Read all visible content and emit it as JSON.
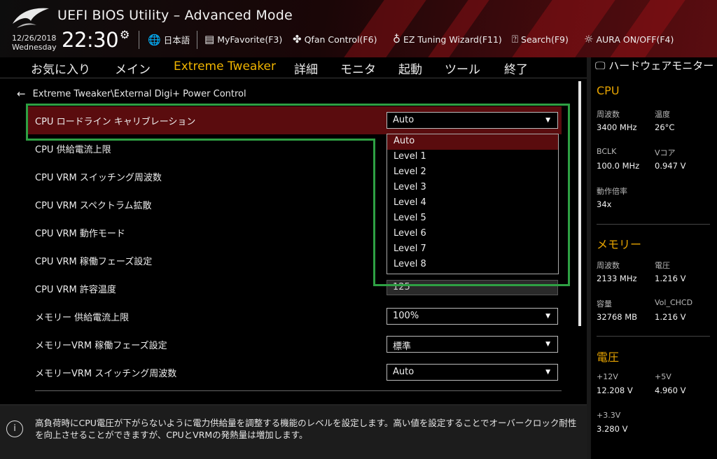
{
  "header": {
    "title": "UEFI BIOS Utility – Advanced Mode",
    "date": "12/26/2018",
    "weekday": "Wednesday",
    "time": "22:30",
    "items": [
      {
        "label": "日本語",
        "icon": "globe-icon"
      },
      {
        "label": "MyFavorite(F3)",
        "icon": "favorite-icon"
      },
      {
        "label": "Qfan Control(F6)",
        "icon": "fan-icon"
      },
      {
        "label": "EZ Tuning Wizard(F11)",
        "icon": "bulb-icon"
      },
      {
        "label": "Search(F9)",
        "icon": "search-icon"
      },
      {
        "label": "AURA ON/OFF(F4)",
        "icon": "aura-icon"
      }
    ]
  },
  "menu": {
    "tabs": [
      "お気に入り",
      "メイン",
      "Extreme Tweaker",
      "詳細",
      "モニタ",
      "起動",
      "ツール",
      "終了"
    ],
    "active": "Extreme Tweaker"
  },
  "breadcrumb": "Extreme Tweaker\\External Digi+ Power Control",
  "settings": [
    {
      "label": "CPU ロードライン キャリブレーション",
      "value": "Auto"
    },
    {
      "label": "CPU 供給電流上限",
      "value": ""
    },
    {
      "label": "CPU VRM スイッチング周波数",
      "value": ""
    },
    {
      "label": "CPU VRM スペクトラム拡散",
      "value": ""
    },
    {
      "label": "CPU VRM 動作モード",
      "value": ""
    },
    {
      "label": "CPU VRM 稼働フェーズ設定",
      "value": ""
    },
    {
      "label": "CPU VRM 許容温度",
      "value": "125"
    },
    {
      "label": "メモリー 供給電流上限",
      "value": "100%"
    },
    {
      "label": "メモリーVRM 稼働フェーズ設定",
      "value": "標準"
    },
    {
      "label": "メモリーVRM スイッチング周波数",
      "value": "Auto"
    }
  ],
  "dropdown": {
    "options": [
      "Auto",
      "Level 1",
      "Level 2",
      "Level 3",
      "Level 4",
      "Level 5",
      "Level 6",
      "Level 7",
      "Level 8"
    ],
    "selected": "Auto"
  },
  "help": {
    "text": "高負荷時にCPU電圧が下がらないように電力供給量を調整する機能のレベルを設定します。高い値を設定することでオーバークロック耐性を向上させることができますが、CPUとVRMの発熱量は増加します。"
  },
  "hw_monitor": {
    "title": "ハードウェアモニター",
    "cpu": {
      "section": "CPU",
      "freq_label": "周波数",
      "freq": "3400 MHz",
      "temp_label": "温度",
      "temp": "26°C",
      "bclk_label": "BCLK",
      "bclk": "100.0 MHz",
      "vcore_label": "Vコア",
      "vcore": "0.947 V",
      "ratio_label": "動作倍率",
      "ratio": "34x"
    },
    "memory": {
      "section": "メモリー",
      "freq_label": "周波数",
      "freq": "2133 MHz",
      "volt_label": "電圧",
      "volt": "1.216 V",
      "cap_label": "容量",
      "cap": "32768 MB",
      "chcd_label": "Vol_CHCD",
      "chcd": "1.216 V"
    },
    "voltage": {
      "section": "電圧",
      "v12_label": "+12V",
      "v12": "12.208 V",
      "v5_label": "+5V",
      "v5": "4.960 V",
      "v33_label": "+3.3V",
      "v33": "3.280 V"
    }
  },
  "colors": {
    "accent": "#f0b400",
    "highlight": "#5a0c0e",
    "annotation": "#2ea043"
  }
}
